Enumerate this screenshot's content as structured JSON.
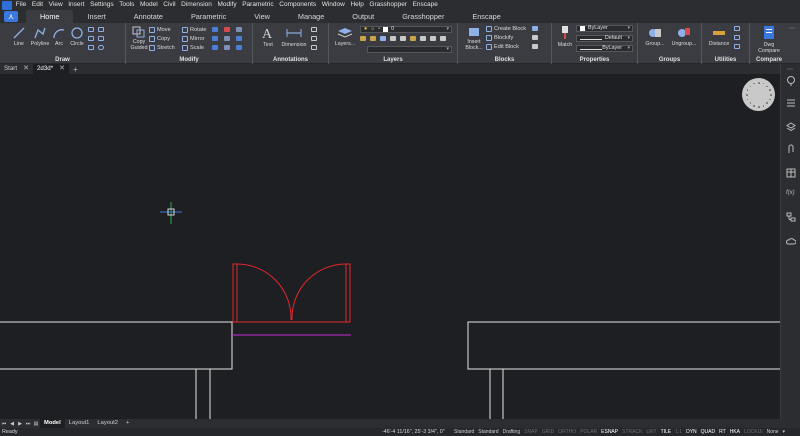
{
  "menu": [
    "File",
    "Edit",
    "View",
    "Insert",
    "Settings",
    "Tools",
    "Model",
    "Civil",
    "Dimension",
    "Modify",
    "Parametric",
    "Components",
    "Window",
    "Help",
    "Grasshopper",
    "Enscape"
  ],
  "ribbon_tabs": [
    "Home",
    "Insert",
    "Annotate",
    "Parametric",
    "View",
    "Manage",
    "Output",
    "Grasshopper",
    "Enscape"
  ],
  "active_ribbon_tab": "Home",
  "panels": {
    "draw": {
      "title": "Draw",
      "tools": [
        "Line",
        "Polyline",
        "Arc",
        "Circle"
      ]
    },
    "modify": {
      "title": "Modify",
      "copy_guided": "Copy\nGuided",
      "copy_guided_l1": "Copy",
      "copy_guided_l2": "Guided",
      "move": "Move",
      "copy": "Copy",
      "stretch": "Stretch",
      "rotate": "Rotate",
      "mirror": "Mirror",
      "scale": "Scale"
    },
    "annotations": {
      "title": "Annotations",
      "text": "Text",
      "dimension": "Dimension"
    },
    "layers": {
      "title": "Layers",
      "layers_btn": "Layers...",
      "current_layer": "0"
    },
    "blocks": {
      "title": "Blocks",
      "insert_l1": "Insert",
      "insert_l2": "Block...",
      "create": "Create Block",
      "blockify": "Blockify",
      "edit": "Edit Block"
    },
    "properties": {
      "title": "Properties",
      "match": "Match",
      "color": "ByLayer",
      "linetype": "Default",
      "lineweight": "ByLayer"
    },
    "groups": {
      "title": "Groups",
      "group": "Group...",
      "ungroup": "Ungroup..."
    },
    "utilities": {
      "title": "Utilities",
      "distance": "Distance"
    },
    "compare": {
      "title": "Compare",
      "dwg_l1": "Dwg",
      "dwg_l2": "Compare"
    }
  },
  "doc_tabs": [
    {
      "label": "Start"
    },
    {
      "label": "2d3d*"
    }
  ],
  "layout_tabs": [
    "Model",
    "Layout1",
    "Layout2"
  ],
  "active_layout": "Model",
  "status": {
    "text": "Ready",
    "coords": "-46'-4 11/16\", 25'-3 3/4\", 0\"",
    "items": [
      {
        "label": "Standard",
        "state": "normal"
      },
      {
        "label": "Standard",
        "state": "normal"
      },
      {
        "label": "Drafting",
        "state": "normal"
      },
      {
        "label": "SNAP",
        "state": "off"
      },
      {
        "label": "GRID",
        "state": "off"
      },
      {
        "label": "ORTHO",
        "state": "off"
      },
      {
        "label": "POLAR",
        "state": "off"
      },
      {
        "label": "ESNAP",
        "state": "on"
      },
      {
        "label": "STRACK",
        "state": "off"
      },
      {
        "label": "LWT",
        "state": "off"
      },
      {
        "label": "TILE",
        "state": "on"
      },
      {
        "label": "1:1",
        "state": "off"
      },
      {
        "label": "DYN",
        "state": "on"
      },
      {
        "label": "QUAD",
        "state": "on"
      },
      {
        "label": "RT",
        "state": "on"
      },
      {
        "label": "HKA",
        "state": "on"
      },
      {
        "label": "LOCKUI",
        "state": "off"
      },
      {
        "label": "None",
        "state": "normal"
      }
    ]
  },
  "colors": {
    "canvas_bg": "#1e1f23",
    "geometry": "#e6e6e6",
    "door_red": "#e0282d",
    "threshold_magenta": "#c82ad6",
    "cursor_green": "#2fa84f",
    "accent_blue": "#3a78df"
  },
  "icons": [
    "nav-wheel-icon",
    "lightbulb-icon",
    "properties-icon",
    "layers-icon",
    "attach-icon",
    "table-icon",
    "fx-icon",
    "hierarchy-icon",
    "cloud-icon"
  ]
}
